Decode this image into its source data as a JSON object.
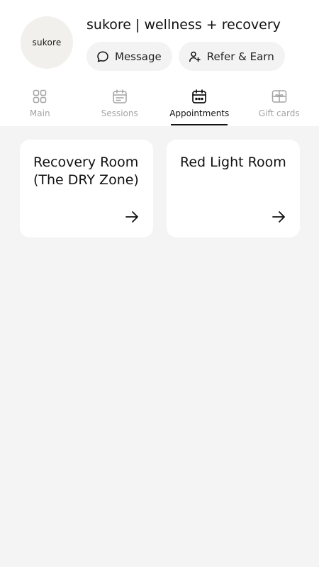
{
  "business": {
    "logo_text": "sukore",
    "name": "sukore | wellness + recovery"
  },
  "actions": {
    "message_label": "Message",
    "refer_label": "Refer & Earn"
  },
  "tabs": [
    {
      "label": "Main",
      "icon": "grid-icon",
      "active": false
    },
    {
      "label": "Sessions",
      "icon": "calendar-list-icon",
      "active": false
    },
    {
      "label": "Appointments",
      "icon": "calendar-dots-icon",
      "active": true
    },
    {
      "label": "Gift cards",
      "icon": "gift-card-icon",
      "active": false
    }
  ],
  "cards": [
    {
      "title": "Recovery Room (The DRY Zone)",
      "icon": "arrow-right-icon"
    },
    {
      "title": "Red Light Room",
      "icon": "arrow-right-icon"
    }
  ],
  "colors": {
    "background": "#f4f4f4",
    "surface": "#ffffff",
    "pill": "#f3f3f3",
    "avatar": "#f1f0ec",
    "text": "#111111",
    "muted": "#a3a3a3"
  }
}
